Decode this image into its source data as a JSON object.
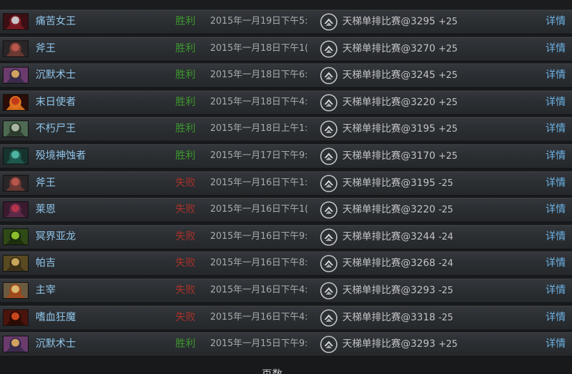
{
  "matches": [
    {
      "hero": "痛苦女王",
      "icon": "queen-of-pain-portrait",
      "result": "胜利",
      "win": true,
      "date": "2015年一月19日下午5:",
      "mode": "天梯单排比赛@3295",
      "delta": "+25",
      "details": "详情",
      "colors": [
        "#3b0f14",
        "#c9c4c6",
        "#7a1a22"
      ]
    },
    {
      "hero": "斧王",
      "icon": "axe-portrait",
      "result": "胜利",
      "win": true,
      "date": "2015年一月18日下午1(",
      "mode": "天梯单排比赛@3270",
      "delta": "+25",
      "details": "详情",
      "colors": [
        "#2a2526",
        "#b8564c",
        "#6e3a33"
      ]
    },
    {
      "hero": "沉默术士",
      "icon": "silencer-portrait",
      "result": "胜利",
      "win": true,
      "date": "2015年一月18日下午6:",
      "mode": "天梯单排比赛@3245",
      "delta": "+25",
      "details": "详情",
      "colors": [
        "#6b3b6e",
        "#d1a260",
        "#3a2a4a"
      ]
    },
    {
      "hero": "末日使者",
      "icon": "doom-portrait",
      "result": "胜利",
      "win": true,
      "date": "2015年一月18日下午4:",
      "mode": "天梯单排比赛@3220",
      "delta": "+25",
      "details": "详情",
      "colors": [
        "#2a0c08",
        "#c23a1a",
        "#e0741e"
      ]
    },
    {
      "hero": "不朽尸王",
      "icon": "undying-portrait",
      "result": "胜利",
      "win": true,
      "date": "2015年一月18日上午1:",
      "mode": "天梯单排比赛@3195",
      "delta": "+25",
      "details": "详情",
      "colors": [
        "#4e6a52",
        "#a9b7a2",
        "#2c3a2e"
      ]
    },
    {
      "hero": "殁境神蚀者",
      "icon": "outworld-devourer-portrait",
      "result": "胜利",
      "win": true,
      "date": "2015年一月17日下午9:",
      "mode": "天梯单排比赛@3170",
      "delta": "+25",
      "details": "详情",
      "colors": [
        "#16342e",
        "#4fb3a1",
        "#1f5a4f"
      ]
    },
    {
      "hero": "斧王",
      "icon": "axe-portrait",
      "result": "失败",
      "win": false,
      "date": "2015年一月16日下午1:",
      "mode": "天梯单排比赛@3195",
      "delta": "-25",
      "details": "详情",
      "colors": [
        "#2a2526",
        "#b8564c",
        "#6e3a33"
      ]
    },
    {
      "hero": "莱恩",
      "icon": "lion-portrait",
      "result": "失败",
      "win": false,
      "date": "2015年一月16日下午1(",
      "mode": "天梯单排比赛@3220",
      "delta": "-25",
      "details": "详情",
      "colors": [
        "#3a1a2e",
        "#b5334a",
        "#5e2a4a"
      ]
    },
    {
      "hero": "冥界亚龙",
      "icon": "viper-portrait",
      "result": "失败",
      "win": false,
      "date": "2015年一月16日下午9:",
      "mode": "天梯单排比赛@3244",
      "delta": "-24",
      "details": "详情",
      "colors": [
        "#2f4a16",
        "#8cbf2e",
        "#1c2e0c"
      ]
    },
    {
      "hero": "帕吉",
      "icon": "pudge-portrait",
      "result": "失败",
      "win": false,
      "date": "2015年一月16日下午8:",
      "mode": "天梯单排比赛@3268",
      "delta": "-24",
      "details": "详情",
      "colors": [
        "#5a4a22",
        "#c7a65a",
        "#3c3018"
      ]
    },
    {
      "hero": "主宰",
      "icon": "juggernaut-portrait",
      "result": "失败",
      "win": false,
      "date": "2015年一月16日下午4:",
      "mode": "天梯单排比赛@3293",
      "delta": "-25",
      "details": "详情",
      "colors": [
        "#6a5a40",
        "#d8b870",
        "#a0481c"
      ]
    },
    {
      "hero": "嗜血狂魔",
      "icon": "bloodseeker-portrait",
      "result": "失败",
      "win": false,
      "date": "2015年一月16日下午4:",
      "mode": "天梯单排比赛@3318",
      "delta": "-25",
      "details": "详情",
      "colors": [
        "#4a140c",
        "#c8461e",
        "#2a0a06"
      ]
    },
    {
      "hero": "沉默术士",
      "icon": "silencer-portrait",
      "result": "胜利",
      "win": true,
      "date": "2015年一月15日下午9:",
      "mode": "天梯单排比赛@3293",
      "delta": "+25",
      "details": "详情",
      "colors": [
        "#6b3b6e",
        "#d1a260",
        "#3a2a4a"
      ]
    }
  ],
  "mode_icon": "ranked-solo-icon",
  "pager": {
    "label": "页数"
  },
  "colors": {
    "win": "#3d9a2e",
    "loss": "#a8322a",
    "hero_name": "#8fc5ea",
    "details": "#6cb3e6"
  }
}
